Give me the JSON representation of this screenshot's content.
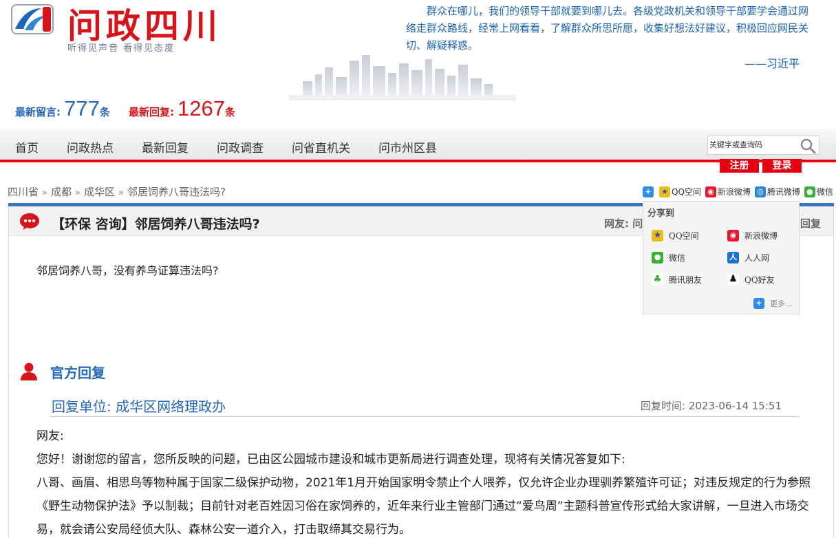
{
  "header": {
    "logo_title": "问政四川",
    "logo_slogan": "听得见声音  看得见态度",
    "quote": "群众在哪儿，我们的领导干部就要到哪儿去。各级党政机关和领导干部要学会通过网络走群众路线，经常上网看看，了解群众所思所愿，收集好想法好建议，积极回应网民关切、解疑释惑。",
    "quote_author": "——习近平",
    "stats": {
      "messages_label": "最新留言:",
      "messages_count": "777",
      "replies_label": "最新回复:",
      "replies_count": "1267",
      "unit": "条"
    }
  },
  "nav": {
    "items": [
      "首页",
      "问政热点",
      "最新回复",
      "问政调查",
      "问省直机关",
      "问市州区县"
    ],
    "search_placeholder": "关键字或查询码",
    "register": "注册",
    "login": "登录"
  },
  "breadcrumb": {
    "items": [
      "四川省",
      "成都",
      "成华区",
      "邻居饲养八哥违法吗?"
    ],
    "separator": "»"
  },
  "share_bar": {
    "items": [
      "QQ空间",
      "新浪微博",
      "腾讯微博",
      "微信"
    ]
  },
  "share_popup": {
    "title": "分享到",
    "items": [
      "QQ空间",
      "新浪微博",
      "微信",
      "人人网",
      "腾讯朋友",
      "QQ好友"
    ],
    "more": "更多..."
  },
  "post": {
    "title": "【环保 咨询】邻居饲养八哥违法吗?",
    "meta_label": "网友: 问",
    "replies_label": "回复",
    "body": "邻居饲养八哥，没有养鸟证算违法吗?"
  },
  "official_reply": {
    "section_title": "官方回复",
    "unit": "回复单位: 成华区网络理政办",
    "time": "回复时间: 2023-06-14 15:51",
    "greeting": "网友:",
    "para1": "您好！谢谢您的留言，您所反映的问题，已由区公园城市建设和城市更新局进行调查处理，现将有关情况答复如下:",
    "para2": "八哥、画眉、相思鸟等物种属于国家二级保护动物，2021年1月开始国家明令禁止个人喂养，仅允许企业办理驯养繁殖许可证；对违反规定的行为参照《野生动物保护法》予以制裁；目前针对老百姓因习俗在家饲养的，近年来行业主管部门通过“爱鸟周”主题科普宣传形式给大家讲解，一旦进入市场交易，就会请公安局经侦大队、森林公安一道介入，打击取缔其交易行为。"
  },
  "colors": {
    "brand_red": "#e60012",
    "brand_blue": "#2768b8",
    "divider_blue": "#3a73c4"
  }
}
